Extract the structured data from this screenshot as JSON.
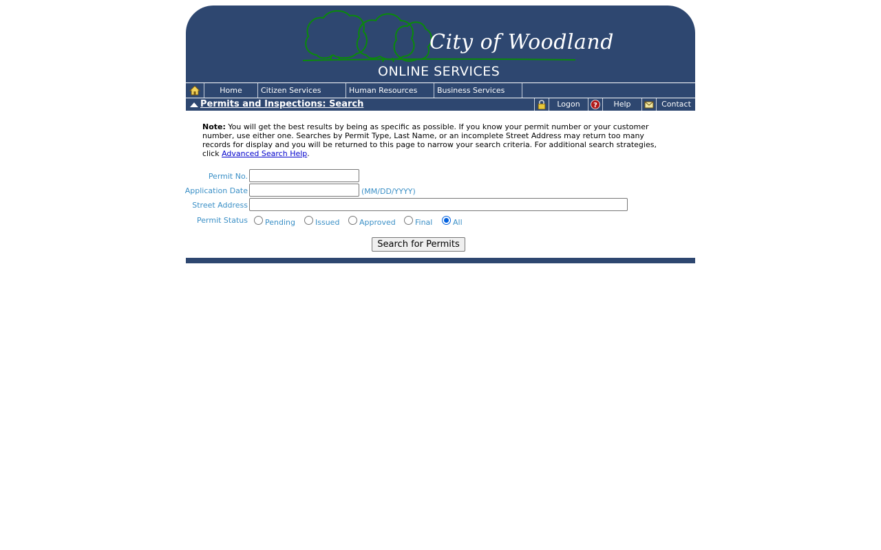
{
  "banner": {
    "city_title": "City of Woodland",
    "subtitle": "ONLINE SERVICES",
    "logo_icon": "trees-logo-icon",
    "colors": {
      "banner_bg": "#2e4770",
      "tree_outline": "#0a8a0a"
    }
  },
  "nav": {
    "home_icon": "house-icon",
    "items": [
      {
        "label": "Home"
      },
      {
        "label": "Citizen Services"
      },
      {
        "label": "Human Resources"
      },
      {
        "label": "Business Services"
      }
    ]
  },
  "titlebar": {
    "collapse_icon": "triangle-up-icon",
    "title": "Permits and Inspections: Search",
    "logon_icon": "padlock-icon",
    "logon": "Logon",
    "help_icon": "question-mark-icon",
    "help": "Help",
    "contact_icon": "envelope-icon",
    "contact": "Contact"
  },
  "note": {
    "label": "Note:",
    "text": " You will get the best results by being as specific as possible. If you know your permit number or your customer number, use either one. Searches by Permit Type, Last Name, or an incomplete Street Address may return too many records for display and you will be returned to this page to narrow your search criteria. For additional search strategies, click ",
    "link": "Advanced Search Help",
    "end": "."
  },
  "form": {
    "permit_no_label": "Permit No.",
    "permit_no_value": "",
    "application_date_label": "Application Date",
    "application_date_value": "",
    "date_format_hint": "(MM/DD/YYYY)",
    "street_address_label": "Street Address",
    "street_address_value": "",
    "permit_status_label": "Permit Status",
    "status_options": [
      "Pending",
      "Issued",
      "Approved",
      "Final",
      "All"
    ],
    "status_selected": "All",
    "submit_label": "Search for Permits"
  }
}
